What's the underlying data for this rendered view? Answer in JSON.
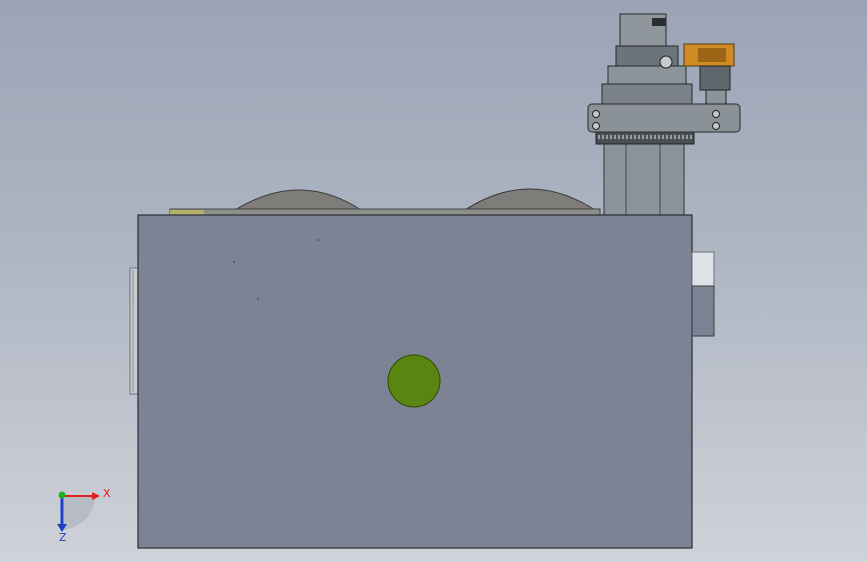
{
  "viewport": {
    "background_top": "#9aa4b5",
    "background_bottom": "#cfd2d8"
  },
  "colors": {
    "housing": "#7b8394",
    "housing_edge": "#2a2d33",
    "housing_top_strip": "#8d8f8a",
    "wheel": "#7f7d79",
    "spindle_steel": "#8c949b",
    "spindle_dark": "#5f666c",
    "clamp_orange": "#cf8a24",
    "port_fitting": "#dfe2e6",
    "indicator_green": "#5a8510",
    "axis_x": "#e02020",
    "axis_y": "#20b020",
    "axis_z": "#2040c8"
  },
  "triad": {
    "x_label": "X",
    "z_label": "Z"
  }
}
